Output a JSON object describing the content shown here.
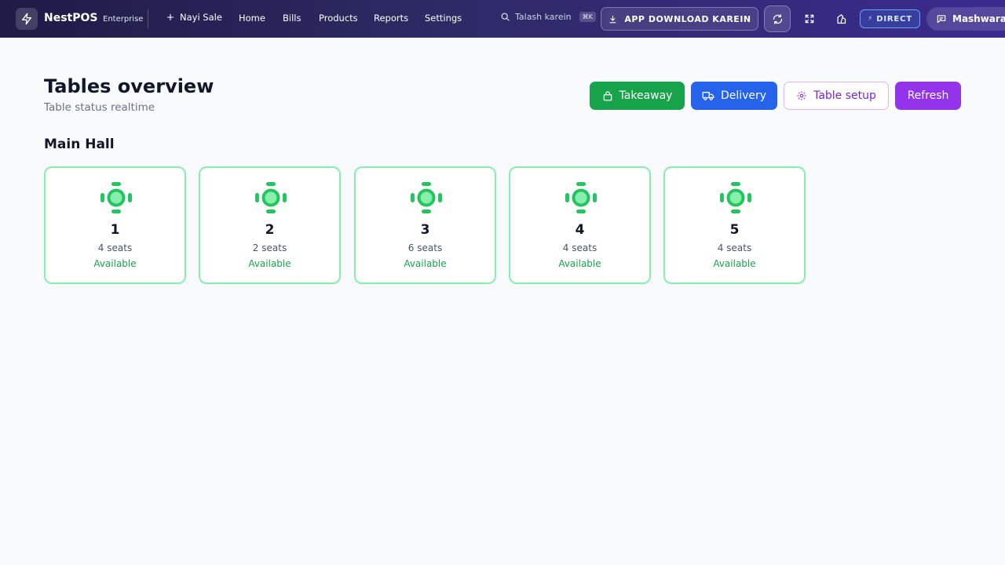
{
  "app": {
    "name": "NestPOS",
    "edition": "Enterprise"
  },
  "nav": {
    "new_sale": "Nayi Sale",
    "items": [
      "Home",
      "Bills",
      "Products",
      "Reports",
      "Settings"
    ]
  },
  "search": {
    "placeholder": "Talash karein",
    "shortcut": "⌘K"
  },
  "topbar": {
    "download_label": "APP DOWNLOAD KAREIN",
    "direct_label": "DIRECT",
    "advice_label": "Mashwara"
  },
  "page": {
    "title": "Tables overview",
    "subtitle": "Table status realtime"
  },
  "actions": {
    "takeaway": "Takeaway",
    "delivery": "Delivery",
    "table_setup": "Table setup",
    "refresh": "Refresh"
  },
  "section": {
    "title": "Main Hall"
  },
  "tables": [
    {
      "number": "1",
      "seats": "4 seats",
      "status": "Available"
    },
    {
      "number": "2",
      "seats": "2 seats",
      "status": "Available"
    },
    {
      "number": "3",
      "seats": "6 seats",
      "status": "Available"
    },
    {
      "number": "4",
      "seats": "4 seats",
      "status": "Available"
    },
    {
      "number": "5",
      "seats": "4 seats",
      "status": "Available"
    }
  ],
  "colors": {
    "available": "#22c55e",
    "takeaway": "#16a34a",
    "delivery": "#2563eb",
    "refresh": "#9333ea"
  },
  "icons": {
    "logo": "lightning-icon",
    "new_sale": "plus-icon",
    "search": "search-icon",
    "download": "download-icon",
    "sync": "sync-icon",
    "expand": "fullscreen-icon",
    "theme": "theme-icon",
    "advice": "chat-icon",
    "takeaway": "shopping-bag-icon",
    "delivery": "truck-icon",
    "setup": "gear-icon",
    "table": "table-icon"
  }
}
